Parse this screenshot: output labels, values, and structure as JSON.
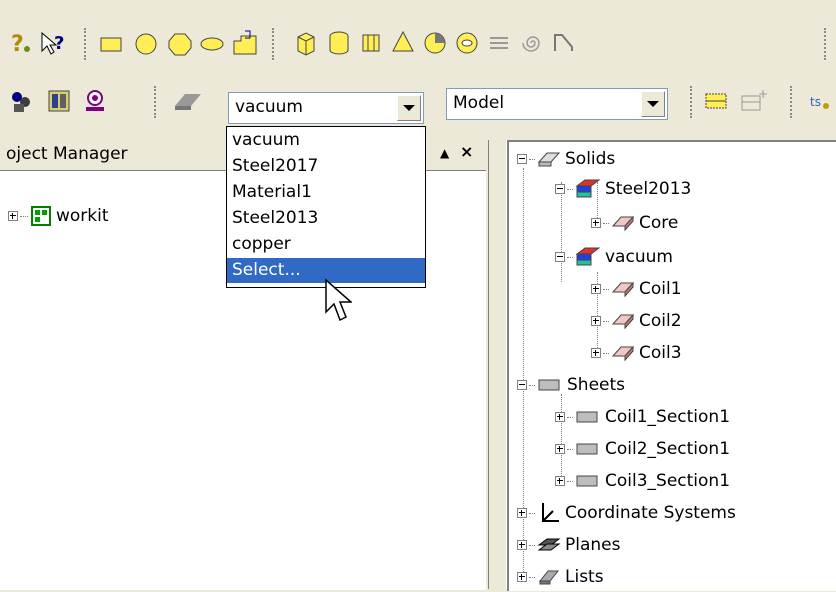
{
  "material_combo": {
    "value": "vacuum"
  },
  "view_combo": {
    "value": "Model"
  },
  "material_dropdown": {
    "options": [
      "vacuum",
      "Steel2017",
      "Material1",
      "Steel2013",
      "copper",
      "Select..."
    ],
    "selected_index": 5
  },
  "project_manager": {
    "title": "oject Manager",
    "project": "workit"
  },
  "model_tree": {
    "solids": "Solids",
    "steel2013": "Steel2013",
    "core": "Core",
    "vacuum": "vacuum",
    "coil1": "Coil1",
    "coil2": "Coil2",
    "coil3": "Coil3",
    "sheets": "Sheets",
    "coil1_section": "Coil1_Section1",
    "coil2_section": "Coil2_Section1",
    "coil3_section": "Coil3_Section1",
    "coordinate_systems": "Coordinate Systems",
    "planes": "Planes",
    "lists": "Lists"
  },
  "colors": {
    "selection": "#316ac5",
    "face": "#ece9d8"
  }
}
